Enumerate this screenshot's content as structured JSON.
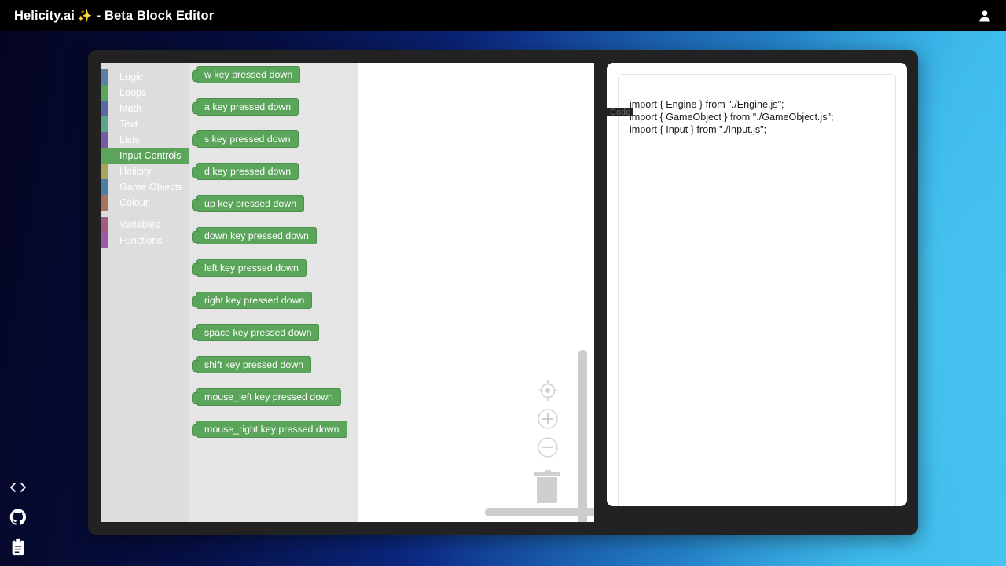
{
  "topbar": {
    "title_main": "Helicity.ai",
    "sparkle": "✨",
    "title_rest": "- Beta Block Editor",
    "account_icon": "person-icon"
  },
  "toolbox": {
    "categories": [
      {
        "label": "Logic",
        "color": "#5b80a5",
        "selected": false
      },
      {
        "label": "Loops",
        "color": "#5ba55b",
        "selected": false
      },
      {
        "label": "Math",
        "color": "#5b67a5",
        "selected": false
      },
      {
        "label": "Text",
        "color": "#5ba58c",
        "selected": false
      },
      {
        "label": "Lists",
        "color": "#745ba5",
        "selected": false
      },
      {
        "label": "Input Controls",
        "color": "#5ba55b",
        "selected": true
      },
      {
        "label": "Helicity",
        "color": "#a5a55b",
        "selected": false
      },
      {
        "label": "Game Objects",
        "color": "#4a7fa5",
        "selected": false
      },
      {
        "label": "Colour",
        "color": "#a5745b",
        "selected": false
      }
    ],
    "categories_secondary": [
      {
        "label": "Variables",
        "color": "#a55b80",
        "selected": false
      },
      {
        "label": "Functions",
        "color": "#9a5ba5",
        "selected": false
      }
    ]
  },
  "flyout": {
    "block_color": "#5ba55b",
    "blocks": [
      {
        "label": "w key pressed down"
      },
      {
        "label": "a key pressed down"
      },
      {
        "label": "s key pressed down"
      },
      {
        "label": "d key pressed down"
      },
      {
        "label": "up key pressed down"
      },
      {
        "label": "down key pressed down"
      },
      {
        "label": "left key pressed down"
      },
      {
        "label": "right key pressed down"
      },
      {
        "label": "space key pressed down"
      },
      {
        "label": "shift key pressed down"
      },
      {
        "label": "mouse_left key pressed down"
      },
      {
        "label": "mouse_right key pressed down"
      }
    ]
  },
  "canvas": {
    "controls": [
      {
        "name": "center-workspace-icon"
      },
      {
        "name": "zoom-in-icon"
      },
      {
        "name": "zoom-out-icon"
      },
      {
        "name": "trash-icon"
      }
    ]
  },
  "code_panel": {
    "legend": "Code",
    "content": "import { Engine } from \"./Engine.js\";\nimport { GameObject } from \"./GameObject.js\";\nimport { Input } from \"./Input.js\";"
  },
  "icon_rail": [
    {
      "name": "code-brackets-icon"
    },
    {
      "name": "github-icon"
    },
    {
      "name": "clipboard-icon"
    }
  ],
  "theme": {
    "accent_green": "#5ba55b",
    "window_bg": "#222222",
    "toolbox_bg": "#dddddd",
    "flyout_bg": "#e5e5e5",
    "topbar_bg": "#000000",
    "gradient_from": "#050520",
    "gradient_to": "#46c2f0"
  }
}
